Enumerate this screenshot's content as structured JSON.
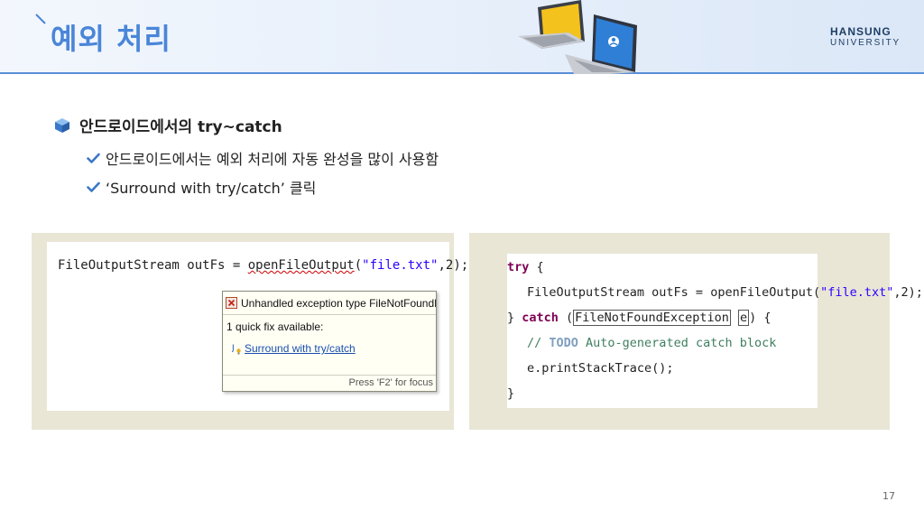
{
  "header": {
    "title": "예외 처리",
    "logo_top": "HANSUNG",
    "logo_bottom": "UNIVERSITY"
  },
  "section": {
    "title": "안드로이드에서의 try~catch",
    "items": [
      "안드로이드에서는 예외 처리에 자동 완성을 많이 사용함",
      "‘Surround with try/catch’ 클릭"
    ]
  },
  "left_panel": {
    "code_prefix": "FileOutputStream outFs = ",
    "code_method": "openFileOutput",
    "code_open": "(",
    "code_string": "\"file.txt\"",
    "code_rest": ",2);",
    "popup_header": "Unhandled exception type FileNotFoundException",
    "popup_sub": "1 quick fix available:",
    "popup_fix": "Surround with try/catch",
    "popup_footer": "Press 'F2' for focus"
  },
  "right_panel": {
    "line1_kw": "try",
    "line1_rest": " {",
    "line2_prefix": "FileOutputStream outFs = openFileOutput(",
    "line2_string": "\"file.txt\"",
    "line2_rest": ",2);",
    "line3_open": "} ",
    "line3_kw": "catch",
    "line3_paren": " (",
    "line3_type": "FileNotFoundException",
    "line3_var": "e",
    "line3_rest": ") {",
    "line4_comment": "// ",
    "line4_todo": "TODO",
    "line4_text": " Auto-generated catch block",
    "line5": "e.printStackTrace();",
    "line6": "}"
  },
  "page_number": "17",
  "colors": {
    "title": "#4a86d8",
    "header_line": "#5a8fd8",
    "check": "#3a78c9",
    "panel_bg": "#e9e6d6"
  },
  "icons": [
    "cube-bullet-icon",
    "check-icon",
    "laptops-illustration",
    "error-icon",
    "lightbulb-icon"
  ]
}
